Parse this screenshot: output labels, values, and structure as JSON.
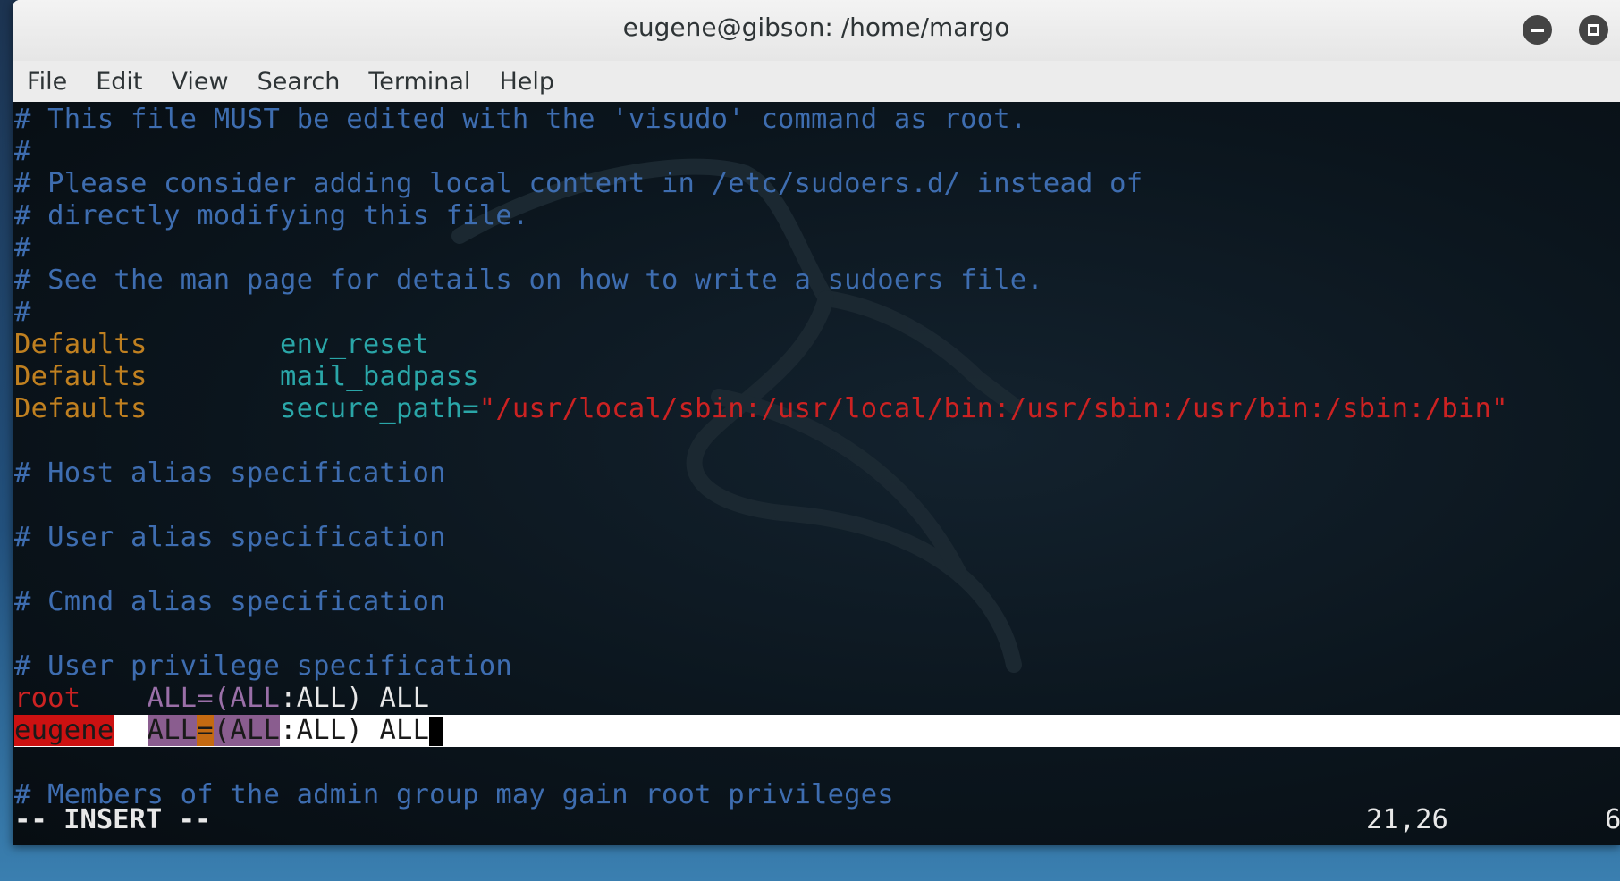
{
  "window": {
    "title": "eugene@gibson: /home/margo"
  },
  "menu": [
    "File",
    "Edit",
    "View",
    "Search",
    "Terminal",
    "Help"
  ],
  "editor": {
    "l1": "# This file MUST be edited with the 'visudo' command as root.",
    "l2": "#",
    "l3": "# Please consider adding local content in /etc/sudoers.d/ instead of",
    "l4": "# directly modifying this file.",
    "l5": "#",
    "l6": "# See the man page for details on how to write a sudoers file.",
    "l7": "#",
    "defaults_kw": "Defaults",
    "env_reset": "env_reset",
    "mail_badpass": "mail_badpass",
    "secure_path_key": "secure_path=",
    "secure_path_val": "\"/usr/local/sbin:/usr/local/bin:/usr/sbin:/usr/bin:/sbin:/bin\"",
    "host_alias": "# Host alias specification",
    "user_alias": "# User alias specification",
    "cmnd_alias": "# Cmnd alias specification",
    "user_priv": "# User privilege specification",
    "root_user": "root",
    "eugene_user": "eugene",
    "spec_all": "ALL",
    "spec_eq": "=",
    "spec_open": "(",
    "spec_rest": ":ALL) ALL",
    "admin_comment": "# Members of the admin group may gain root privileges"
  },
  "status": {
    "mode": "-- INSERT --",
    "position": "21,26",
    "percent": "6"
  }
}
